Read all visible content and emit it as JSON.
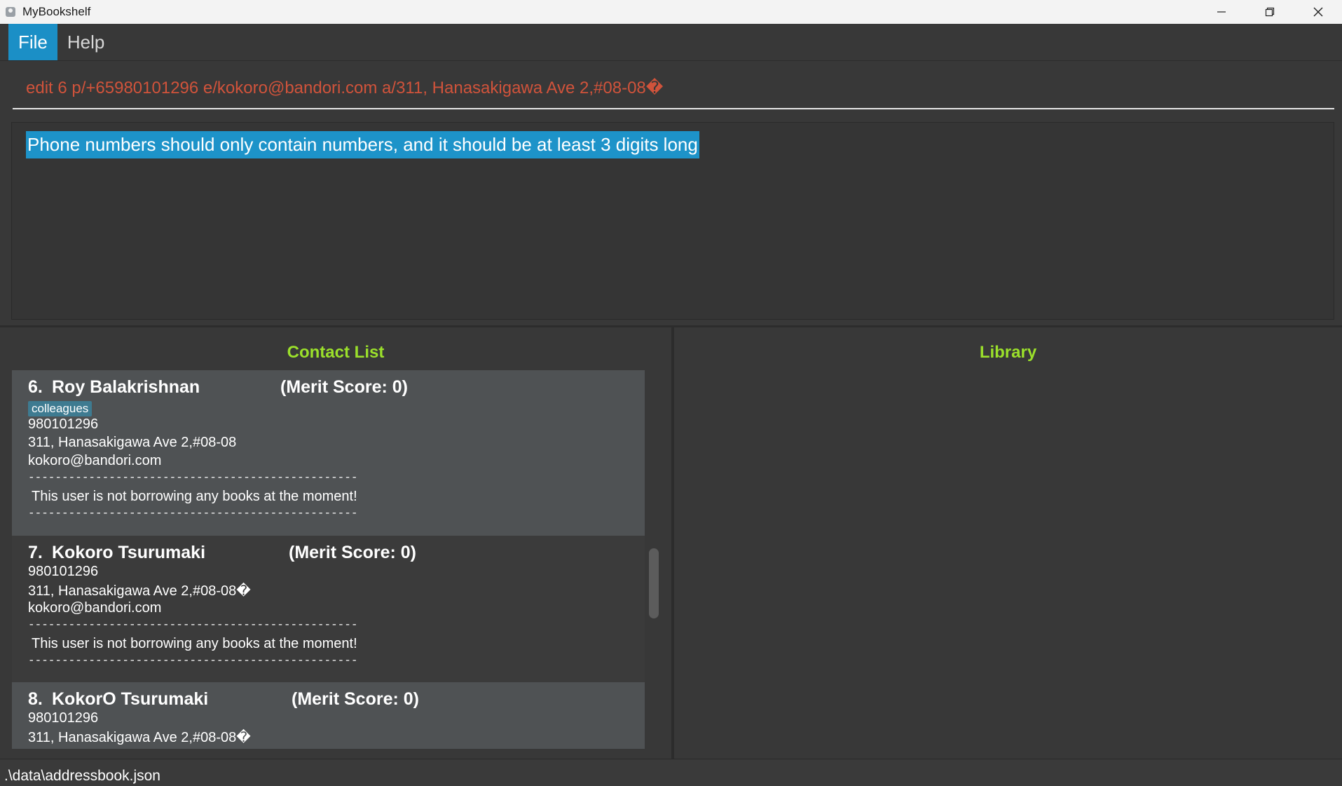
{
  "window": {
    "title": "MyBookshelf",
    "icon": "app-icon",
    "controls": [
      "minimize-icon",
      "restore-icon",
      "close-icon"
    ]
  },
  "menu": {
    "items": [
      {
        "label": "File",
        "active": true
      },
      {
        "label": "Help",
        "active": false
      }
    ]
  },
  "command": {
    "value": "edit 6 p/+65980101296 e/kokoro@bandori.com a/311, Hanasakigawa Ave 2,#08-08�",
    "color": "#d0533b"
  },
  "result": {
    "text": "Phone numbers should only contain numbers, and it should be at least 3 digits long",
    "highlight_color": "#1d93c9"
  },
  "contacts": {
    "title": "Contact List",
    "title_color": "#9be02b",
    "divider": "------------------------------------------------------------",
    "items": [
      {
        "index": "6.",
        "name": "Roy Balakrishnan",
        "merit": "(Merit Score: 0)",
        "tag": "colleagues",
        "phone": "980101296",
        "address": "311, Hanasakigawa Ave 2,#08-08",
        "email": "kokoro@bandori.com",
        "borrow": "This user is not borrowing any books at the moment!"
      },
      {
        "index": "7.",
        "name": "Kokoro Tsurumaki",
        "merit": "(Merit Score: 0)",
        "tag": "",
        "phone": "980101296",
        "address": "311, Hanasakigawa Ave 2,#08-08�",
        "email": "kokoro@bandori.com",
        "borrow": "This user is not borrowing any books at the moment!"
      },
      {
        "index": "8.",
        "name": "KokorO Tsurumaki",
        "merit": "(Merit Score: 0)",
        "tag": "",
        "phone": "980101296",
        "address": "311, Hanasakigawa Ave 2,#08-08�",
        "email": "",
        "borrow": ""
      }
    ]
  },
  "library": {
    "title": "Library"
  },
  "status": {
    "path": ".\\data\\addressbook.json"
  }
}
